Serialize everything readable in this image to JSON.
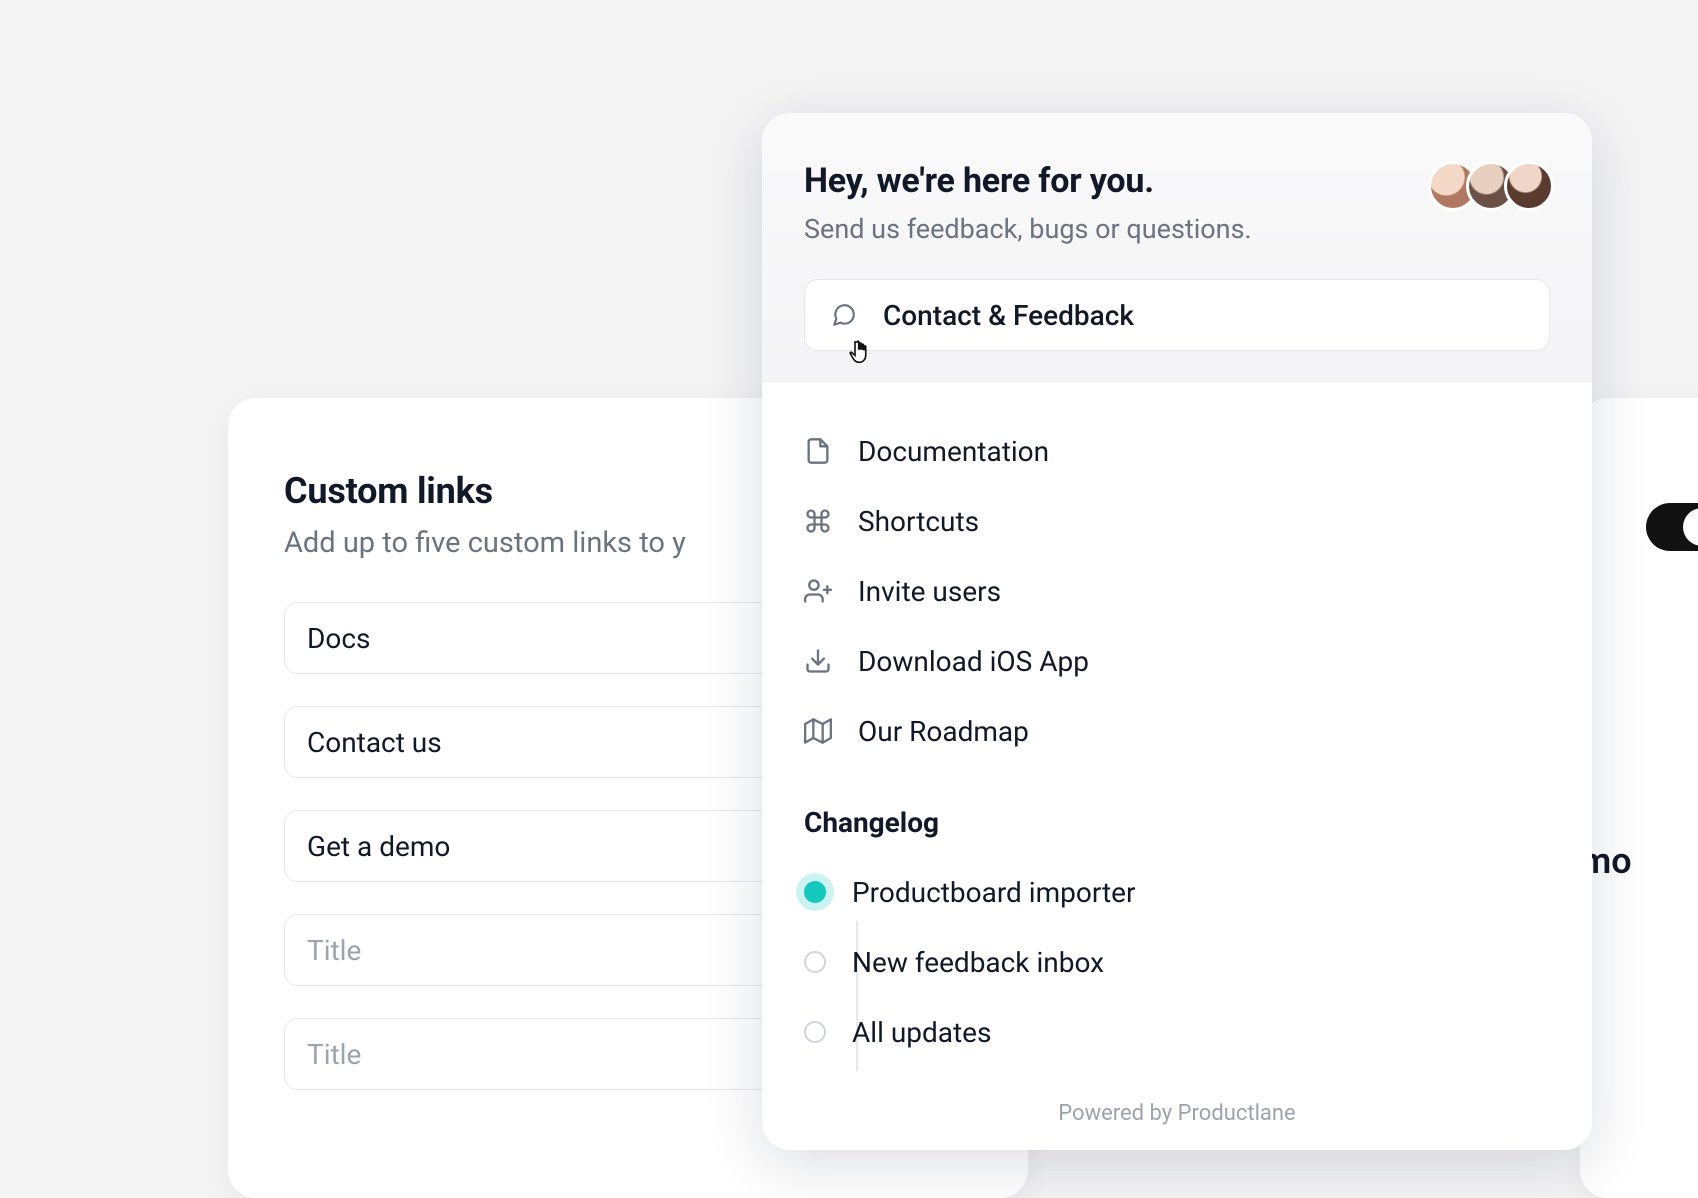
{
  "left_card": {
    "title": "Custom links",
    "subtitle": "Add up to five custom links to y",
    "links": [
      {
        "value": "Docs"
      },
      {
        "value": "Contact us"
      },
      {
        "value": "Get a demo"
      },
      {
        "value": "",
        "placeholder": "Title"
      },
      {
        "value": "",
        "placeholder": "Title"
      }
    ]
  },
  "right_card": {
    "visible_text": "mo"
  },
  "widget": {
    "title": "Hey, we're here for you.",
    "subtitle": "Send us feedback, bugs or questions.",
    "contact_label": "Contact & Feedback",
    "menu": [
      {
        "icon": "file-icon",
        "label": "Documentation"
      },
      {
        "icon": "command-icon",
        "label": "Shortcuts"
      },
      {
        "icon": "user-plus-icon",
        "label": "Invite users"
      },
      {
        "icon": "download-icon",
        "label": "Download iOS App"
      },
      {
        "icon": "map-icon",
        "label": "Our Roadmap"
      }
    ],
    "changelog_title": "Changelog",
    "changelog": [
      {
        "label": "Productboard importer",
        "active": true
      },
      {
        "label": "New feedback inbox",
        "active": false
      },
      {
        "label": "All updates",
        "active": false
      }
    ],
    "powered_by": "Powered by Productlane"
  }
}
